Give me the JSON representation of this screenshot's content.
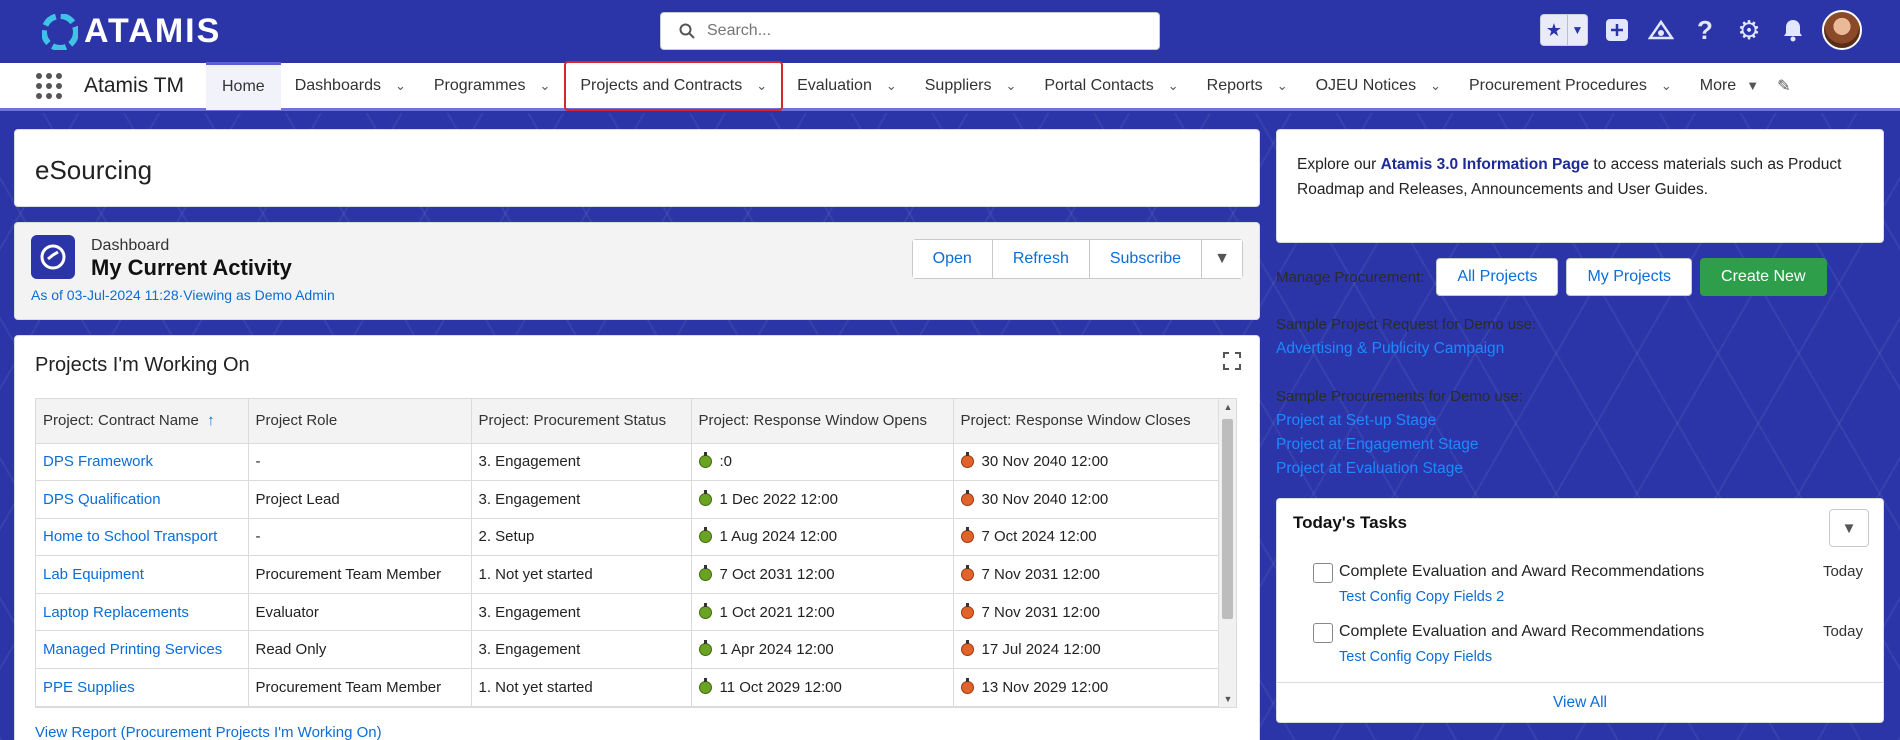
{
  "header": {
    "logo_text": "ATAMIS",
    "search_placeholder": "Search..."
  },
  "nav": {
    "app_name": "Atamis TM",
    "items": [
      {
        "label": "Home"
      },
      {
        "label": "Dashboards"
      },
      {
        "label": "Programmes"
      },
      {
        "label": "Projects and Contracts"
      },
      {
        "label": "Evaluation"
      },
      {
        "label": "Suppliers"
      },
      {
        "label": "Portal Contacts"
      },
      {
        "label": "Reports"
      },
      {
        "label": "OJEU Notices"
      },
      {
        "label": "Procurement Procedures"
      }
    ],
    "more_label": "More"
  },
  "esourcing": {
    "title": "eSourcing"
  },
  "dashboard": {
    "subtitle": "Dashboard",
    "title": "My Current Activity",
    "as_of": "As of 03-Jul-2024 11:28·Viewing as Demo Admin",
    "buttons": {
      "open": "Open",
      "refresh": "Refresh",
      "subscribe": "Subscribe"
    }
  },
  "projects": {
    "title": "Projects I'm Working On",
    "columns": [
      "Project: Contract Name",
      "Project Role",
      "Project: Procurement Status",
      "Project: Response Window Opens",
      "Project: Response Window Closes"
    ],
    "sort_indicator": "↑",
    "rows": [
      {
        "name": "DPS Framework",
        "role": "-",
        "status": "3. Engagement",
        "opens": ":0",
        "closes": "30 Nov 2040 12:00"
      },
      {
        "name": "DPS Qualification",
        "role": "Project Lead",
        "status": "3. Engagement",
        "opens": "1 Dec 2022 12:00",
        "closes": "30 Nov 2040 12:00"
      },
      {
        "name": "Home to School Transport",
        "role": "-",
        "status": "2. Setup",
        "opens": "1 Aug 2024 12:00",
        "closes": "7 Oct 2024 12:00"
      },
      {
        "name": "Lab Equipment",
        "role": "Procurement Team Member",
        "status": "1. Not yet started",
        "opens": "7 Oct 2031 12:00",
        "closes": "7 Nov 2031 12:00"
      },
      {
        "name": "Laptop Replacements",
        "role": "Evaluator",
        "status": "3. Engagement",
        "opens": "1 Oct 2021 12:00",
        "closes": "7 Nov 2031 12:00"
      },
      {
        "name": "Managed Printing Services",
        "role": "Read Only",
        "status": "3. Engagement",
        "opens": "1 Apr 2024 12:00",
        "closes": "17 Jul 2024 12:00"
      },
      {
        "name": "PPE Supplies",
        "role": "Procurement Team Member",
        "status": "1. Not yet started",
        "opens": "11 Oct 2029 12:00",
        "closes": "13 Nov 2029 12:00"
      }
    ],
    "view_report": "View Report (Procurement Projects I'm Working On)"
  },
  "info": {
    "prefix": "Explore our ",
    "link": "Atamis 3.0 Information Page",
    "suffix": " to access materials such as Product Roadmap and Releases, Announcements and User Guides."
  },
  "manage": {
    "label": "Manage Procurement:",
    "all_projects": "All Projects",
    "my_projects": "My Projects",
    "create_new": "Create New"
  },
  "samples": {
    "request_label": "Sample Project Request for Demo use:",
    "request_link": "Advertising & Publicity Campaign",
    "procurements_label": "Sample Procurements for Demo use:",
    "procurement_links": [
      "Project at Set-up Stage",
      "Project at Engagement Stage",
      "Project at Evaluation Stage"
    ]
  },
  "tasks": {
    "title": "Today's Tasks",
    "items": [
      {
        "title": "Complete Evaluation and Award Recommendations",
        "sub": "Test Config Copy Fields 2",
        "due": "Today"
      },
      {
        "title": "Complete Evaluation and Award Recommendations",
        "sub": "Test Config Copy Fields",
        "due": "Today"
      }
    ],
    "view_all": "View All"
  },
  "colors": {
    "brand": "#2b35a8",
    "link": "#0b6dd8",
    "create_button": "#2e9e4a",
    "highlight_border": "#d9242b"
  }
}
